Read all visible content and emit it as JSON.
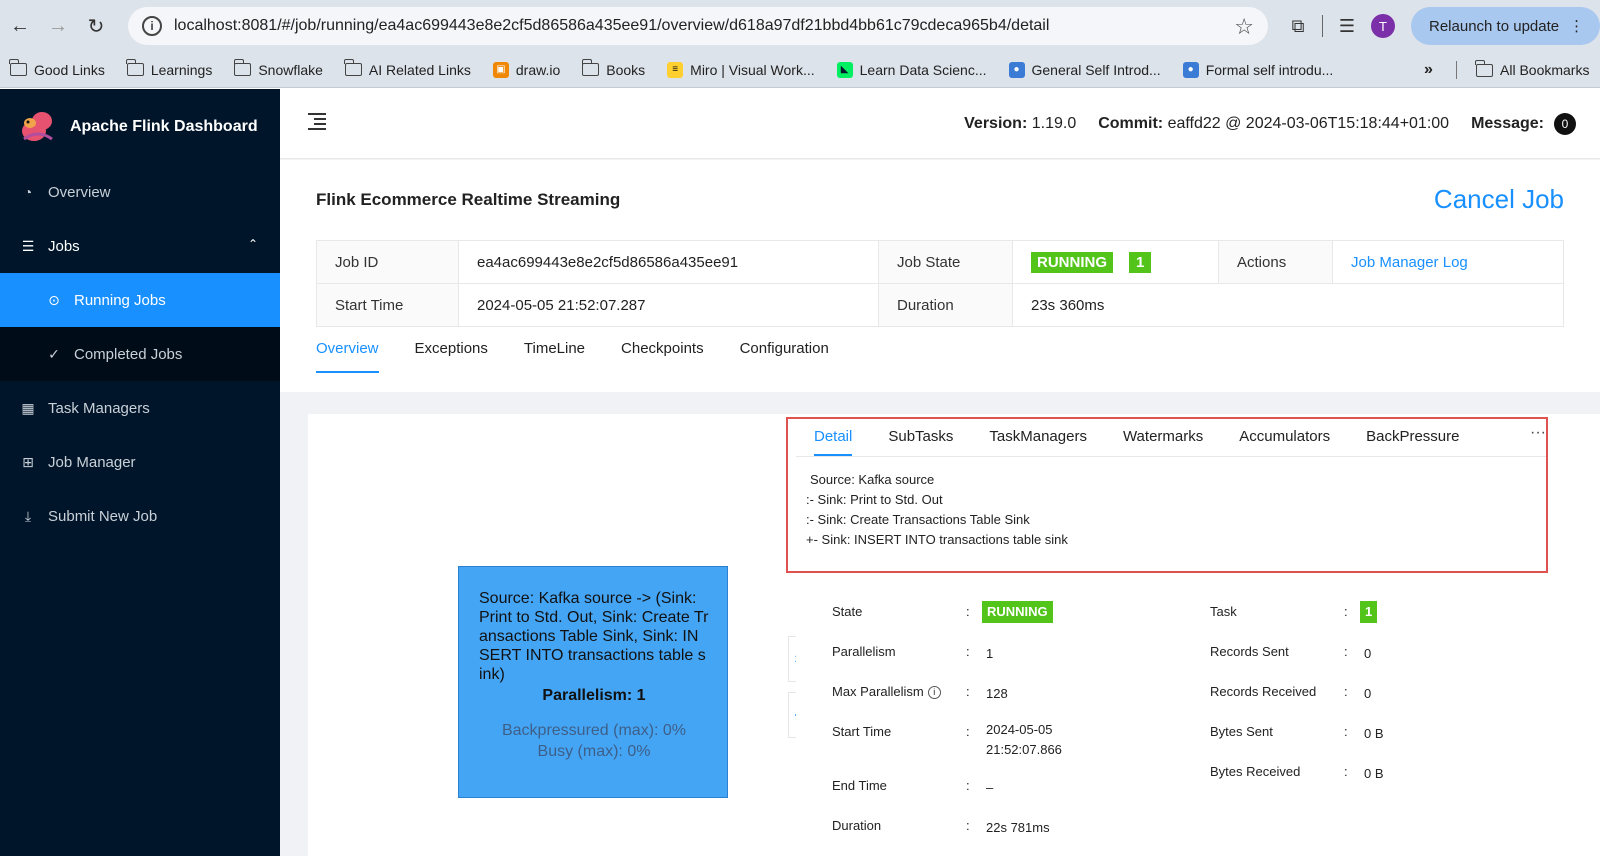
{
  "browser": {
    "url": "localhost:8081/#/job/running/ea4ac699443e8e2cf5d86586a435ee91/overview/d618a97df21bbd4bb61c79cdeca965b4/detail",
    "profile_initial": "T",
    "relaunch_label": "Relaunch to update",
    "bookmarks": [
      {
        "label": "Good Links",
        "icon": "folder-icon"
      },
      {
        "label": "Learnings",
        "icon": "folder-icon"
      },
      {
        "label": "Snowflake",
        "icon": "folder-icon"
      },
      {
        "label": "AI Related Links",
        "icon": "folder-icon"
      },
      {
        "label": "draw.io",
        "icon": "drawio-icon"
      },
      {
        "label": "Books",
        "icon": "folder-icon"
      },
      {
        "label": "Miro | Visual Work...",
        "icon": "miro-icon"
      },
      {
        "label": "Learn Data Scienc...",
        "icon": "datacamp-icon"
      },
      {
        "label": "General Self Introd...",
        "icon": "people-icon"
      },
      {
        "label": "Formal self introdu...",
        "icon": "people-icon"
      }
    ],
    "more_bookmarks": "»",
    "all_bookmarks": "All Bookmarks"
  },
  "sidebar": {
    "brand": "Apache Flink Dashboard",
    "overview": "Overview",
    "jobs": "Jobs",
    "running_jobs": "Running Jobs",
    "completed_jobs": "Completed Jobs",
    "task_managers": "Task Managers",
    "job_manager": "Job Manager",
    "submit_new_job": "Submit New Job"
  },
  "topbar": {
    "version_label": "Version:",
    "version": "1.19.0",
    "commit_label": "Commit:",
    "commit": "eaffd22 @ 2024-03-06T15:18:44+01:00",
    "message_label": "Message:",
    "message_count": "0"
  },
  "job": {
    "name": "Flink Ecommerce Realtime Streaming",
    "cancel_label": "Cancel Job",
    "id_label": "Job ID",
    "id": "ea4ac699443e8e2cf5d86586a435ee91",
    "state_label": "Job State",
    "state": "RUNNING",
    "state_count": "1",
    "actions_label": "Actions",
    "actions_link": "Job Manager Log",
    "start_label": "Start Time",
    "start": "2024-05-05 21:52:07.287",
    "duration_label": "Duration",
    "duration": "23s 360ms"
  },
  "tabs": [
    "Overview",
    "Exceptions",
    "TimeLine",
    "Checkpoints",
    "Configuration"
  ],
  "node": {
    "title": "Source: Kafka source -> (Sink: Print to Std. Out, Sink: Create Transactions Table Sink, Sink: INSERT INTO transactions table sink)",
    "parallelism": "Parallelism: 1",
    "backpressured": "Backpressured (max): 0%",
    "busy": "Busy (max): 0%"
  },
  "detail": {
    "tabs": [
      "Detail",
      "SubTasks",
      "TaskManagers",
      "Watermarks",
      "Accumulators",
      "BackPressure"
    ],
    "more": "···",
    "plan": [
      "Source: Kafka source",
      ":- Sink: Print to Std. Out",
      ":- Sink: Create Transactions Table Sink",
      "+- Sink: INSERT INTO transactions table sink"
    ],
    "left": [
      {
        "label": "State",
        "value": "RUNNING"
      },
      {
        "label": "Parallelism",
        "value": "1"
      },
      {
        "label": "Max Parallelism",
        "value": "128"
      },
      {
        "label": "Start Time",
        "value": "2024-05-05",
        "value2": "21:52:07.866"
      },
      {
        "label": "End Time",
        "value": "–"
      },
      {
        "label": "Duration",
        "value": "22s 781ms"
      }
    ],
    "right": [
      {
        "label": "Task",
        "value": "1"
      },
      {
        "label": "Records Sent",
        "value": "0"
      },
      {
        "label": "Records Received",
        "value": "0"
      },
      {
        "label": "Bytes Sent",
        "value": "0 B"
      },
      {
        "label": "Bytes Received",
        "value": "0 B"
      }
    ],
    "colon": ":",
    "info_glyph": "i"
  },
  "colors": {
    "accent": "#1890ff",
    "sidebar_bg": "#001529",
    "running": "#52c41a",
    "node_fill": "#45a5f5",
    "highlight_border": "#e05252"
  }
}
